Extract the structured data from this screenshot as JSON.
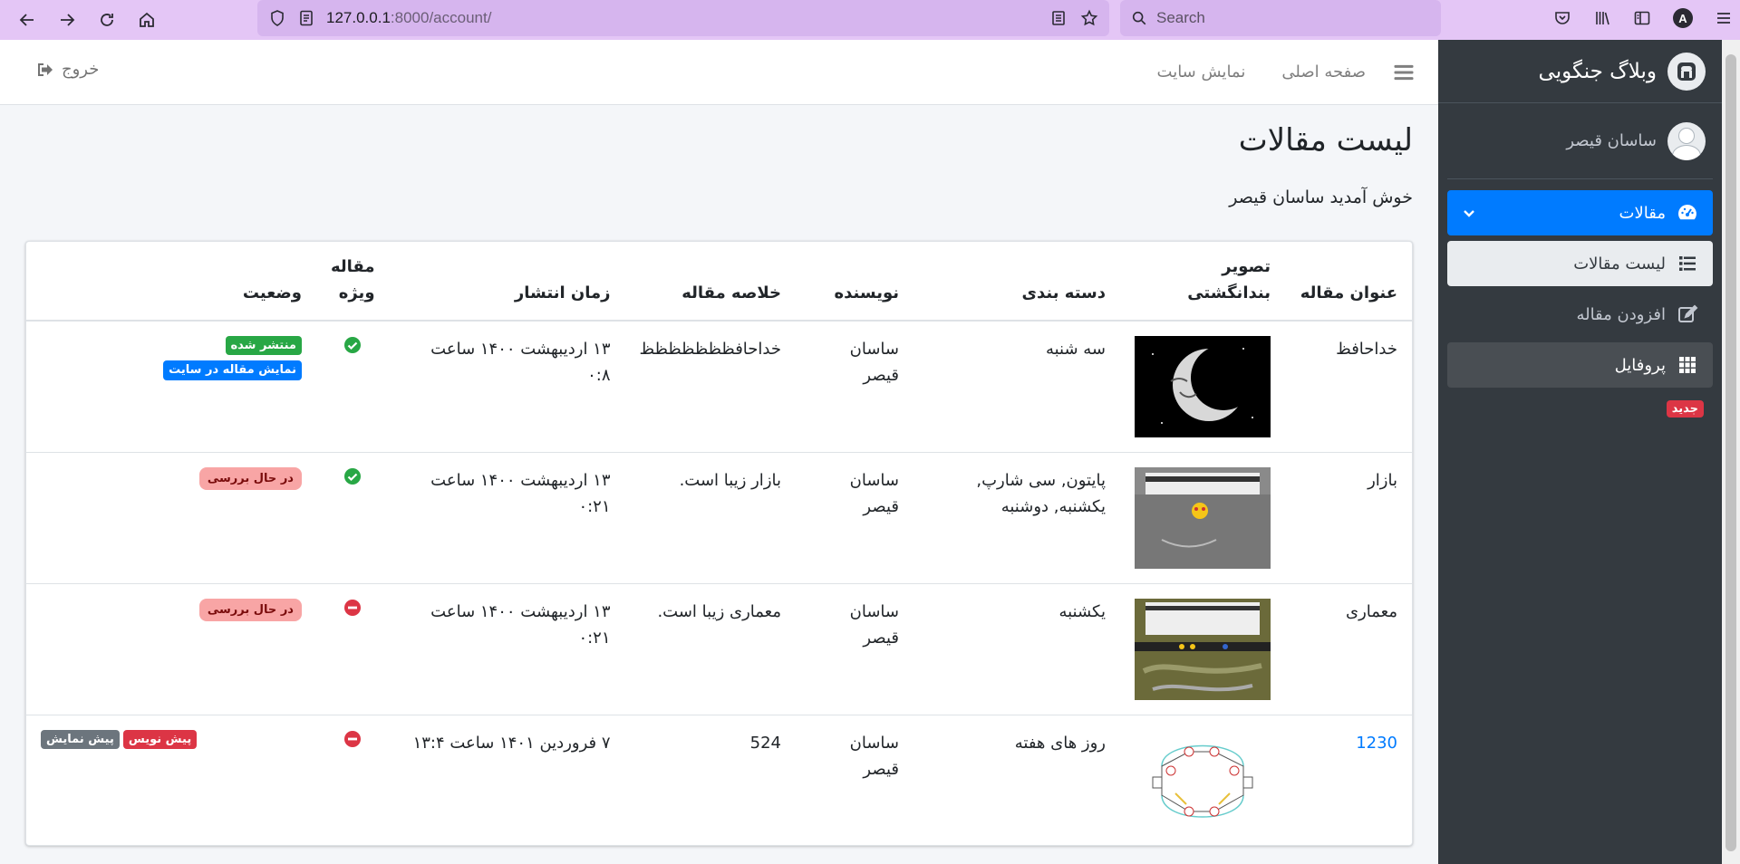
{
  "browser": {
    "url_host": "127.0.0.1",
    "url_path": ":8000/account/",
    "search_placeholder": "Search",
    "profile_letter": "A"
  },
  "sidebar": {
    "brand": "وبلاگ جنگویی",
    "user_name": "ساسان قیصر",
    "menu": {
      "articles": "مقالات",
      "article_list": "لیست مقالات",
      "add_article": "افزودن مقاله",
      "profile": "پروفایل"
    },
    "new_badge": "جدید"
  },
  "topnav": {
    "home": "صفحه اصلی",
    "view_site": "نمایش سایت",
    "logout": "خروج"
  },
  "page": {
    "title": "لیست مقالات",
    "welcome": "خوش آمدید ساسان قیصر"
  },
  "table": {
    "headers": {
      "title": "عنوان مقاله",
      "thumbnail": "تصویر بندانگشتی",
      "category": "دسته بندی",
      "author": "نویسنده",
      "summary": "خلاصه مقاله",
      "publish_time": "زمان انتشار",
      "special": "مقاله ویژه",
      "status": "وضعیت"
    },
    "rows": [
      {
        "title": "خداحافظ",
        "thumb": "moon-image",
        "category": "سه شنبه",
        "author": "ساسان قیصر",
        "summary": "خداحافظظظظظظظ",
        "publish_time": "۱۳ اردیبهشت ۱۴۰۰ ساعت ۰:۸",
        "special": true,
        "badges": [
          {
            "text": "منتشر شده",
            "color": "#28a745"
          },
          {
            "text": "نمایش مقاله در سایت",
            "color": "#007bff"
          }
        ]
      },
      {
        "title": "بازار",
        "thumb": "phone-screenshot",
        "category": "پایتون, سی شارپ, یکشنبه, دوشنبه",
        "author": "ساسان قیصر",
        "summary": "بازار زیبا است.",
        "publish_time": "۱۳ اردیبهشت ۱۴۰۰ ساعت ۰:۲۱",
        "special": true,
        "badges": [
          {
            "text": "در حال بررسی",
            "color": "#f8a5a5"
          }
        ]
      },
      {
        "title": "معماری",
        "thumb": "phone-screenshot-2",
        "category": "یکشنبه",
        "author": "ساسان قیصر",
        "summary": "معماری زیبا است.",
        "publish_time": "۱۳ اردیبهشت ۱۴۰۰ ساعت ۰:۲۱",
        "special": false,
        "badges": [
          {
            "text": "در حال بررسی",
            "color": "#f8a5a5"
          }
        ]
      },
      {
        "title": "1230",
        "thumb": "diagram-image",
        "category": "روز های هفته",
        "author": "ساسان قیصر",
        "summary": "524",
        "publish_time": "۷ فروردین ۱۴۰۱ ساعت ۱۳:۴",
        "special": false,
        "badges": [
          {
            "text": "پیش نمایش",
            "color": "#6c757d"
          },
          {
            "text": "پیش نویس",
            "color": "#dc3545"
          }
        ]
      }
    ]
  },
  "colors": {
    "accent": "#007bff",
    "sidebar_bg": "#343a40",
    "success": "#28a745",
    "danger": "#dc3545",
    "browser_bar": "#e4c6f6"
  }
}
